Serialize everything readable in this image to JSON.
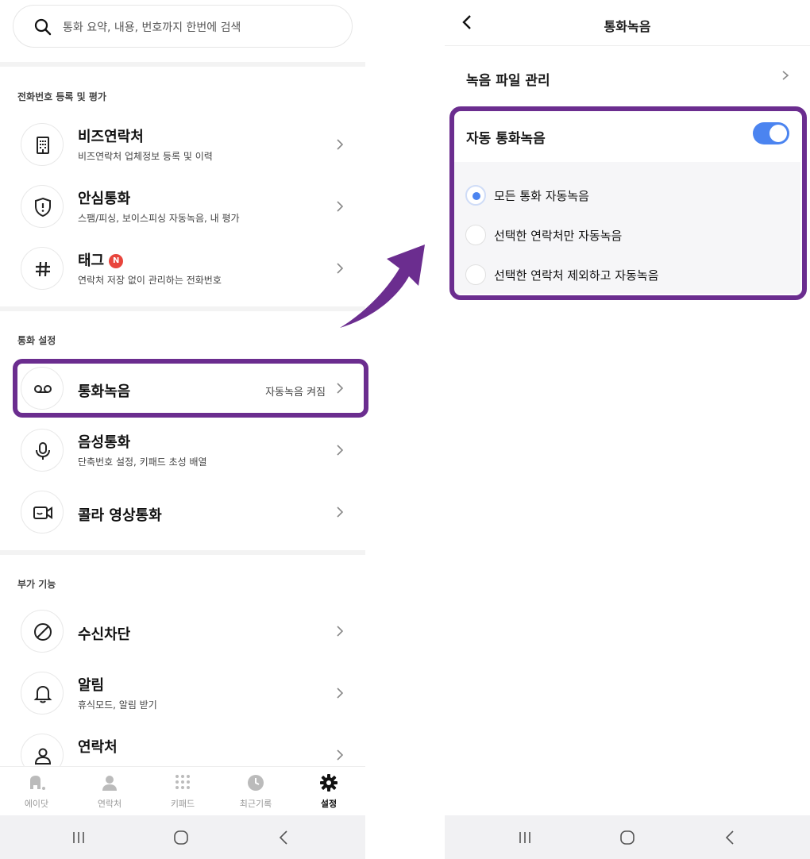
{
  "left": {
    "search_placeholder": "통화 요약, 내용, 번호까지 한번에 검색",
    "section1_title": "전화번호 등록 및 평가",
    "section2_title": "통화 설정",
    "section3_title": "부가 기능",
    "items": [
      {
        "title": "비즈연락처",
        "sub": "비즈연락처 업체정보 등록 및 이력"
      },
      {
        "title": "안심통화",
        "sub": "스팸/피싱, 보이스피싱 자동녹음, 내 평가"
      },
      {
        "title": "태그",
        "badge": "N",
        "sub": "연락처 저장 없이 관리하는 전화번호"
      },
      {
        "title": "통화녹음",
        "right": "자동녹음 켜짐"
      },
      {
        "title": "음성통화",
        "sub": "단축번호 설정, 키패드 초성 배열"
      },
      {
        "title": "콜라 영상통화"
      },
      {
        "title": "수신차단"
      },
      {
        "title": "알림",
        "sub": "휴식모드, 알림 받기"
      },
      {
        "title": "연락처"
      }
    ],
    "tabs": [
      {
        "label": "에이닷",
        "icon": "adot-icon"
      },
      {
        "label": "연락처",
        "icon": "person-icon"
      },
      {
        "label": "키패드",
        "icon": "keypad-icon"
      },
      {
        "label": "최근기록",
        "icon": "clock-icon"
      },
      {
        "label": "설정",
        "icon": "gear-icon",
        "active": true
      }
    ]
  },
  "right": {
    "header_title": "통화녹음",
    "file_manage": "녹음 파일 관리",
    "auto_record": "자동 통화녹음",
    "auto_record_on": true,
    "options": [
      {
        "label": "모든 통화 자동녹음",
        "selected": true
      },
      {
        "label": "선택한 연락처만 자동녹음",
        "selected": false
      },
      {
        "label": "선택한 연락처 제외하고 자동녹음",
        "selected": false
      }
    ]
  },
  "colors": {
    "highlight": "#6b2d8f",
    "accent_blue": "#4b84f0",
    "badge_red": "#e8453c"
  }
}
